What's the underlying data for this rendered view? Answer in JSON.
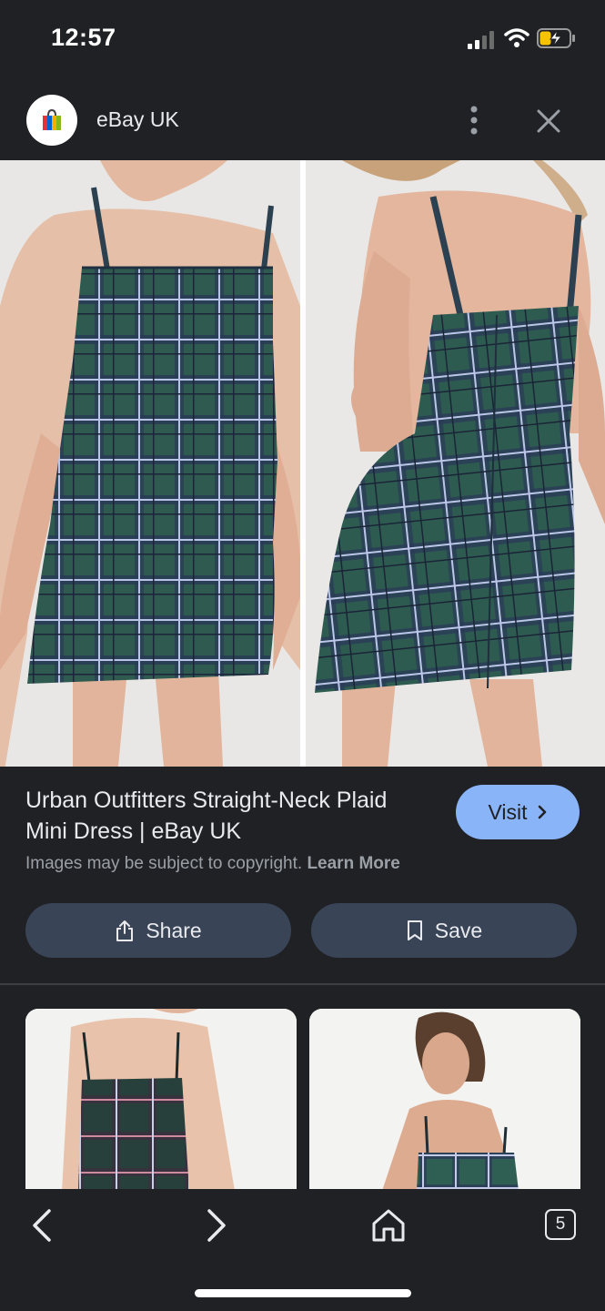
{
  "status_bar": {
    "time": "12:57"
  },
  "header": {
    "site_name": "eBay UK"
  },
  "result": {
    "title": "Urban Outfitters Straight-Neck Plaid Mini Dress | eBay UK",
    "visit_label": "Visit",
    "copyright_text": "Images may be subject to copyright.",
    "learn_more": "Learn More",
    "share_label": "Share",
    "save_label": "Save"
  },
  "toolbar": {
    "tab_count": "5"
  },
  "icons": [
    "signal-icon",
    "wifi-icon",
    "battery-icon",
    "shopping-bag-icon",
    "more-vert-icon",
    "close-icon",
    "chevron-right-icon",
    "share-icon",
    "bookmark-icon",
    "back-icon",
    "forward-icon",
    "home-icon"
  ],
  "colors": {
    "background": "#202124",
    "accent": "#8ab4f8",
    "button": "#394457",
    "secondary_text": "#9aa0a6"
  }
}
